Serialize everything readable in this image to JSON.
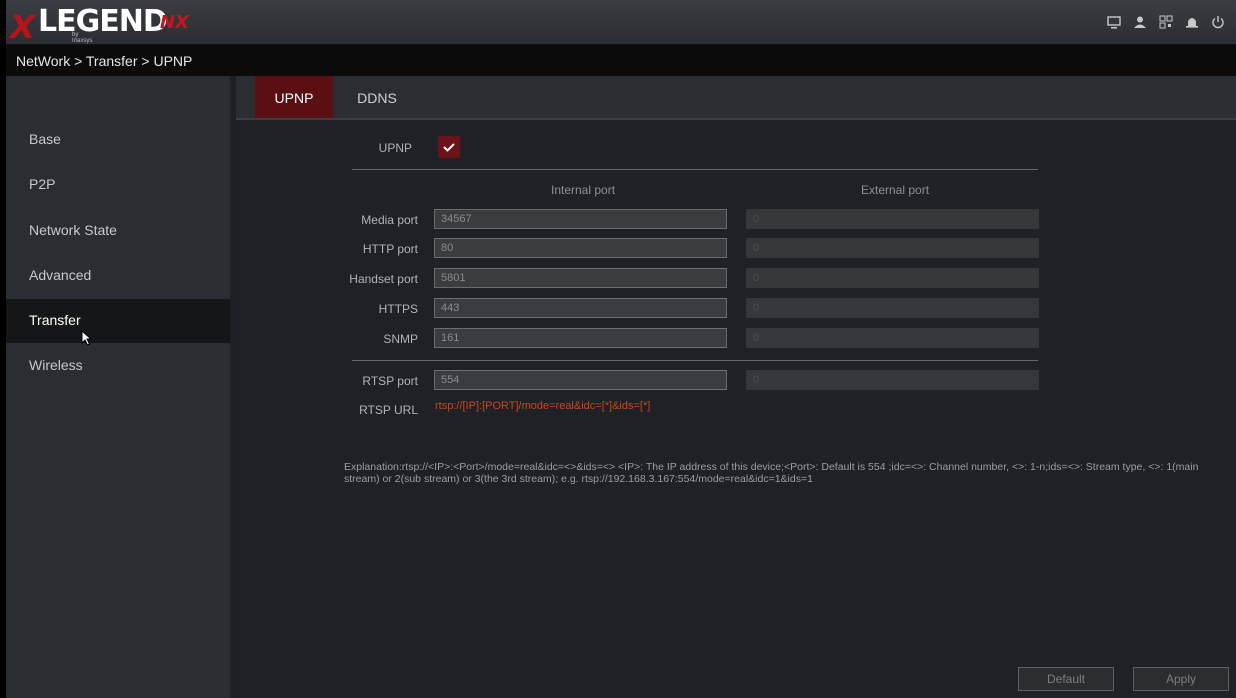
{
  "header": {
    "logo": {
      "mark": "X",
      "word": "LEGEND",
      "suffix": "NX",
      "sub": "by Inaxsys"
    },
    "icons": [
      "monitor-icon",
      "user-icon",
      "qr-code-icon",
      "alarm-icon",
      "power-icon"
    ]
  },
  "breadcrumb": "NetWork  >  Transfer  >  UPNP",
  "sidebar": {
    "items": [
      {
        "label": "Base"
      },
      {
        "label": "P2P"
      },
      {
        "label": "Network State"
      },
      {
        "label": "Advanced"
      },
      {
        "label": "Transfer",
        "active": true
      },
      {
        "label": "Wireless"
      }
    ]
  },
  "tabs": [
    {
      "label": "UPNP",
      "active": true
    },
    {
      "label": "DDNS"
    }
  ],
  "upnp": {
    "enable_label": "UPNP",
    "enabled": true,
    "internal_header": "Internal port",
    "external_header": "External port",
    "ports": [
      {
        "label": "Media port",
        "internal": "34567",
        "external": "0"
      },
      {
        "label": "HTTP port",
        "internal": "80",
        "external": "0"
      },
      {
        "label": "Handset port",
        "internal": "5801",
        "external": "0"
      },
      {
        "label": "HTTPS",
        "internal": "443",
        "external": "0"
      },
      {
        "label": "SNMP",
        "internal": "161",
        "external": "0"
      }
    ],
    "rtsp": {
      "label": "RTSP port",
      "internal": "554",
      "external": "0"
    },
    "rtsp_url_label": "RTSP URL",
    "rtsp_url": "rtsp://[IP]:[PORT]/mode=real&idc=[*]&ids=[*]",
    "explanation": "Explanation:rtsp://<IP>:<Port>/mode=real&idc=<>&ids=<> <IP>: The IP address of this device;<Port>: Default is 554 ;idc=<>: Channel number, <>: 1-n;ids=<>: Stream type, <>: 1(main stream) or 2(sub stream) or 3(the 3rd stream); e.g. rtsp://192.168.3.167:554/mode=real&idc=1&ids=1"
  },
  "buttons": {
    "default": "Default",
    "apply": "Apply"
  },
  "colors": {
    "accent": "#6e1219",
    "active_tab": "#5a0f13",
    "url": "#c9471c"
  }
}
